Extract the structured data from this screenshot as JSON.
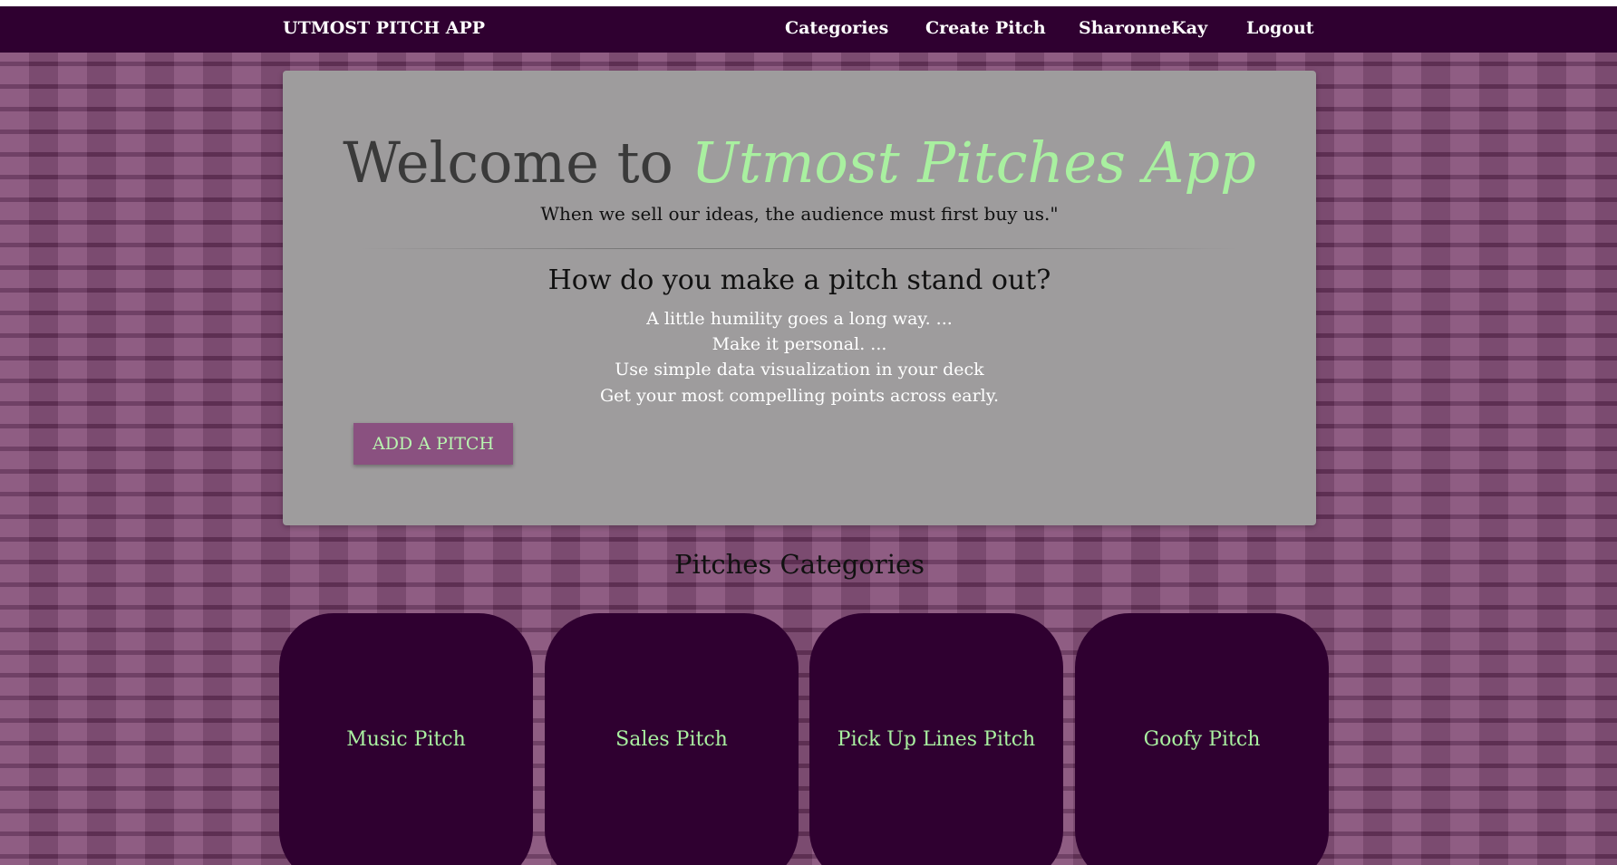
{
  "navbar": {
    "brand": "UTMOST PITCH APP",
    "links": [
      "Categories",
      "Create Pitch",
      "SharonneKay",
      "Logout"
    ]
  },
  "hero": {
    "welcome_prefix": "Welcome to",
    "welcome_accent": "Utmost Pitches App",
    "quote": "When we sell our ideas, the audience must first buy us.\"",
    "question": "How do you make a pitch stand out?",
    "tips": [
      "A little humility goes a long way. ...",
      "Make it personal. ...",
      "Use simple data visualization in your deck",
      "Get your most compelling points across early."
    ],
    "add_button": "ADD A PITCH"
  },
  "categories": {
    "title": "Pitches Categories",
    "items": [
      "Music Pitch",
      "Sales Pitch",
      "Pick Up Lines Pitch",
      "Goofy Pitch"
    ]
  },
  "colors": {
    "navbar": "#2f0030",
    "accent_green": "#a9f0a0",
    "button": "#8a5180",
    "panel": "#9e9c9d",
    "background": "#86517a"
  }
}
